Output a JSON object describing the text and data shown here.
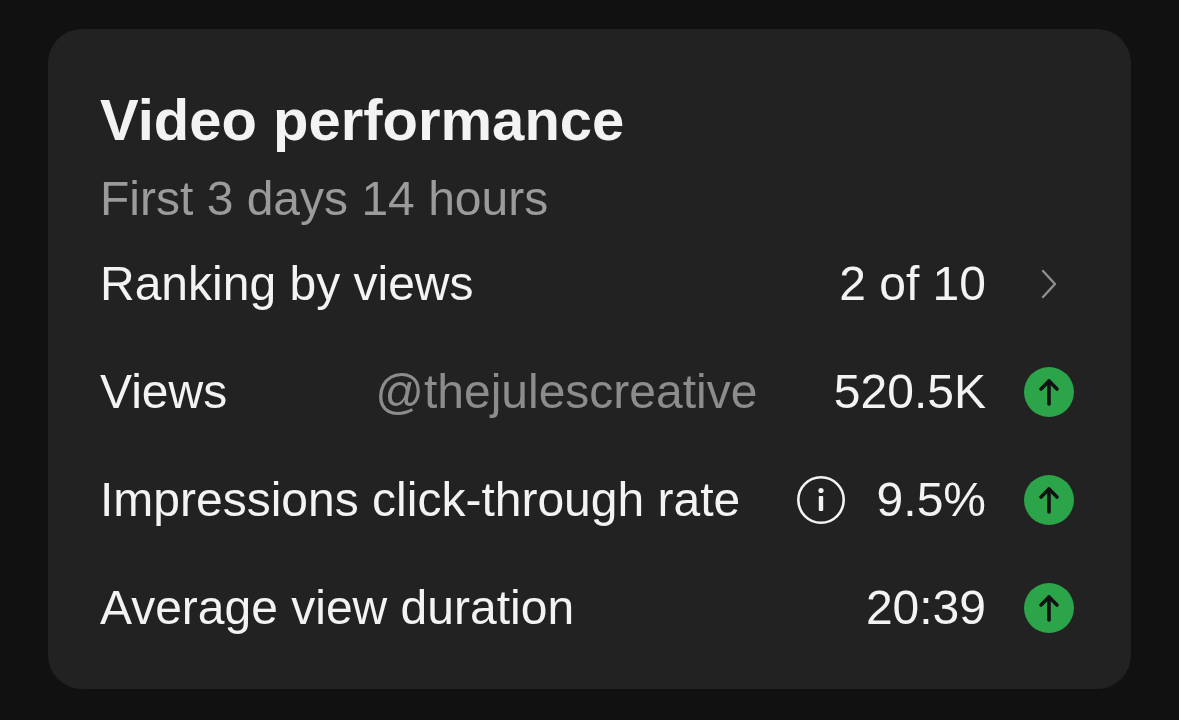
{
  "card": {
    "title": "Video performance",
    "subtitle": "First 3 days 14 hours"
  },
  "metrics": [
    {
      "kind": "link",
      "label": "Ranking by views",
      "info": false,
      "value": "2 of 10"
    },
    {
      "kind": "trend",
      "label": "Views",
      "overlay": "@thejulescreative",
      "info": false,
      "value": "520.5K",
      "rising": true
    },
    {
      "kind": "trend",
      "label": "Impressions click-through rate",
      "info": true,
      "value": "9.5%",
      "rising": true
    },
    {
      "kind": "trend",
      "label": "Average view duration",
      "info": false,
      "value": "20:39",
      "rising": true
    }
  ]
}
